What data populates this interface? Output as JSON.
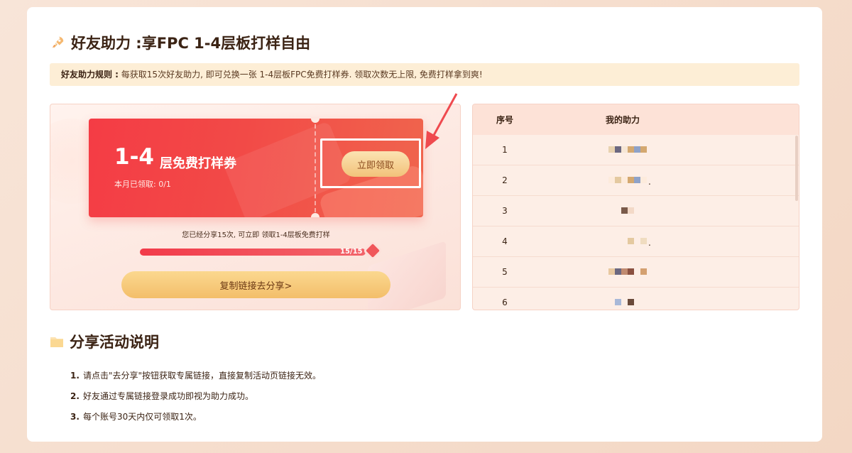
{
  "header": {
    "title": "好友助力 :享FPC 1-4层板打样自由",
    "rules_label": "好友助力规则 :",
    "rules_text": " 每获取15次好友助力, 即可兑换一张 1-4层板FPC免费打样券. 领取次数无上限, 免费打样拿到爽!"
  },
  "coupon": {
    "layers": "1-4",
    "title": "层免费打样券",
    "claimed_text": "本月已领取: 0/1",
    "claim_button": "立即领取"
  },
  "progress": {
    "message": "您已经分享15次, 可立即 领取1-4层板免费打样",
    "label": "15/15",
    "fraction": 1.0
  },
  "share_button": "复制链接去分享>",
  "helpers_table": {
    "headers": [
      "序号",
      "我的助力"
    ],
    "rows": [
      {
        "index": "1",
        "mosaic": [
          "#e8d2b0",
          "#6b6780",
          "#f6e6d6",
          "#d4a870",
          "#8fa2c8",
          "#d4a870"
        ],
        "trail": ""
      },
      {
        "index": "2",
        "mosaic": [
          "#fdebdc",
          "#e4c9a0",
          "#fdebdc",
          "#d4a870",
          "#8fa2c8",
          "#fdebdc"
        ],
        "trail": "."
      },
      {
        "index": "3",
        "mosaic": [
          "#fdeee6",
          "#fdeee6",
          "#7a5a4a",
          "#f3d9c7"
        ],
        "trail": ""
      },
      {
        "index": "4",
        "mosaic": [
          "#fdeee6",
          "#fdeee6",
          "#fdeee6",
          "#e4c9a0",
          "#fdeee6",
          "#f0dcc0"
        ],
        "trail": "."
      },
      {
        "index": "5",
        "mosaic": [
          "#e8c8a0",
          "#6b6780",
          "#c08a70",
          "#8a5040",
          "#fdeee6",
          "#d4a070"
        ],
        "trail": ""
      },
      {
        "index": "6",
        "mosaic": [
          "#fdeee6",
          "#a8b8d8",
          "#fdeee6",
          "#6a4a3a"
        ],
        "trail": ""
      }
    ]
  },
  "instructions": {
    "title": "分享活动说明",
    "items": [
      {
        "num": "1.",
        "text": "请点击\"去分享\"按钮获取专属链接，直接复制活动页链接无效。"
      },
      {
        "num": "2.",
        "text": "好友通过专属链接登录成功即视为助力成功。"
      },
      {
        "num": "3.",
        "text": "每个账号30天内仅可领取1次。"
      }
    ]
  },
  "colors": {
    "coupon_red": "#f24a47",
    "accent_gold": "#f3be6a",
    "arrow": "#ef4a4f"
  },
  "icons": {
    "title_icon": "rocket-icon",
    "instructions_icon": "folder-icon"
  }
}
